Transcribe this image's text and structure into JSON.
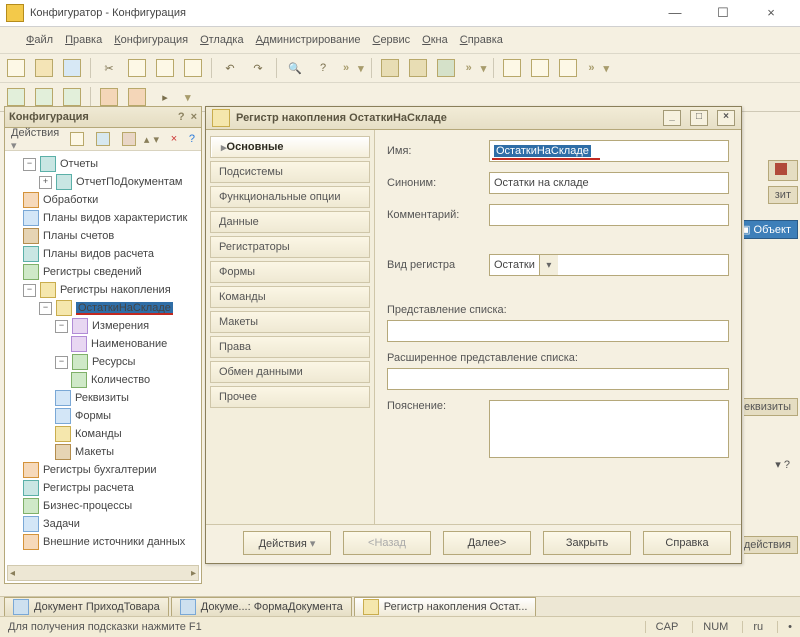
{
  "window": {
    "title": "Конфигуратор - Конфигурация",
    "min": "—",
    "max": "☐",
    "close": "×"
  },
  "menubar": {
    "items": [
      "Файл",
      "Правка",
      "Конфигурация",
      "Отладка",
      "Администрирование",
      "Сервис",
      "Окна",
      "Справка"
    ]
  },
  "config_panel": {
    "title": "Конфигурация",
    "actions_label": "Действия"
  },
  "tree": {
    "n0": {
      "label": "Отчеты"
    },
    "n1": {
      "label": "ОтчетПоДокументам"
    },
    "n2": {
      "label": "Обработки"
    },
    "n3": {
      "label": "Планы видов характеристик"
    },
    "n4": {
      "label": "Планы счетов"
    },
    "n5": {
      "label": "Планы видов расчета"
    },
    "n6": {
      "label": "Регистры сведений"
    },
    "n7": {
      "label": "Регистры накопления"
    },
    "n8": {
      "label": "ОстаткиНаСкладе"
    },
    "n9": {
      "label": "Измерения"
    },
    "n10": {
      "label": "Наименование"
    },
    "n11": {
      "label": "Ресурсы"
    },
    "n12": {
      "label": "Количество"
    },
    "n13": {
      "label": "Реквизиты"
    },
    "n14": {
      "label": "Формы"
    },
    "n15": {
      "label": "Команды"
    },
    "n16": {
      "label": "Макеты"
    },
    "n17": {
      "label": "Регистры бухгалтерии"
    },
    "n18": {
      "label": "Регистры расчета"
    },
    "n19": {
      "label": "Бизнес-процессы"
    },
    "n20": {
      "label": "Задачи"
    },
    "n21": {
      "label": "Внешние источники данных"
    }
  },
  "editor": {
    "title": "Регистр накопления ОстаткиНаСкладе",
    "tabs": {
      "t0": "Основные",
      "t1": "Подсистемы",
      "t2": "Функциональные опции",
      "t3": "Данные",
      "t4": "Регистраторы",
      "t5": "Формы",
      "t6": "Команды",
      "t7": "Макеты",
      "t8": "Права",
      "t9": "Обмен данными",
      "t10": "Прочее"
    },
    "form": {
      "name_label": "Имя:",
      "name_value": "ОстаткиНаСкладе",
      "syn_label": "Синоним:",
      "syn_value": "Остатки на складе",
      "comment_label": "Комментарий:",
      "kind_label": "Вид регистра",
      "kind_value": "Остатки",
      "list_repr_label": "Представление списка:",
      "ext_list_repr_label": "Расширенное представление списка:",
      "explanation_label": "Пояснение:"
    },
    "buttons": {
      "actions": "Действия",
      "back": "<Назад",
      "next": "Далее>",
      "close": "Закрыть",
      "help": "Справка"
    }
  },
  "right": {
    "zit": "зит",
    "obj": "Объект",
    "rekv": "Реквизиты",
    "deistv": "действия"
  },
  "docktabs": {
    "d0": "Документ ПриходТовара",
    "d1": "Докуме...: ФормаДокумента",
    "d2": "Регистр накопления Остат..."
  },
  "statusbar": {
    "hint": "Для получения подсказки нажмите F1",
    "cap": "CAP",
    "num": "NUM",
    "lang": "ru"
  }
}
